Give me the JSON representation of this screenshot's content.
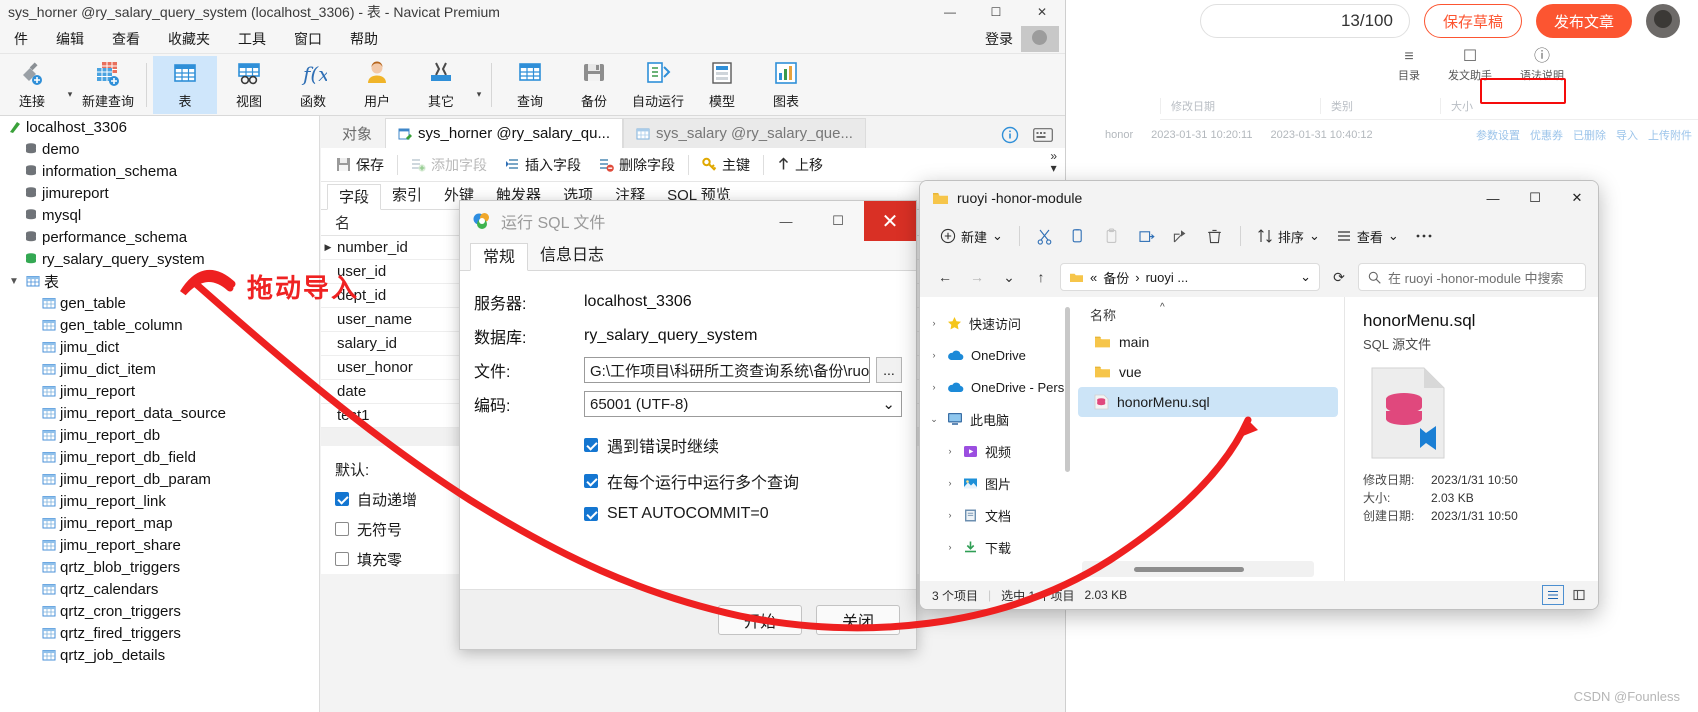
{
  "csdn": {
    "counter": "13/100",
    "save_draft": "保存草稿",
    "publish": "发布文章",
    "avatar": "user-avatar",
    "tools": [
      {
        "icon": "list-outline-icon",
        "label": "目录"
      },
      {
        "icon": "assistant-icon",
        "label": "发文助手"
      },
      {
        "icon": "help-circle-icon",
        "label": "语法说明"
      }
    ],
    "table_headers": [
      "修改日期",
      "类别",
      "大小"
    ],
    "table_row": {
      "name": "honor",
      "c1": "2023-01-31 10:20:11",
      "c2": "2023-01-31 10:40:12"
    },
    "row_links": [
      "参数设置",
      "优惠券",
      "已删除",
      "导入",
      "上传附件"
    ],
    "watermark": "CSDN @Founless"
  },
  "navicat": {
    "title": "sys_horner @ry_salary_query_system (localhost_3306) - 表 - Navicat Premium",
    "window_buttons": {
      "minimize": "—",
      "maximize": "☐",
      "close": "✕"
    },
    "menus": [
      "件",
      "编辑",
      "查看",
      "收藏夹",
      "工具",
      "窗口",
      "帮助"
    ],
    "login_label": "登录",
    "toolbar": [
      {
        "label": "连接",
        "icon": "connection-icon",
        "caret": true,
        "active": false
      },
      {
        "label": "新建查询",
        "icon": "new-query-icon",
        "caret": false,
        "active": false
      },
      {
        "label": "表",
        "icon": "table-icon",
        "caret": false,
        "active": true
      },
      {
        "label": "视图",
        "icon": "view-icon",
        "caret": false,
        "active": false
      },
      {
        "label": "函数",
        "icon": "function-icon",
        "caret": false,
        "active": false
      },
      {
        "label": "用户",
        "icon": "user-icon",
        "caret": false,
        "active": false
      },
      {
        "label": "其它",
        "icon": "other-tools-icon",
        "caret": true,
        "active": false
      },
      {
        "label": "查询",
        "icon": "query-icon",
        "caret": false,
        "active": false
      },
      {
        "label": "备份",
        "icon": "backup-icon",
        "caret": false,
        "active": false
      },
      {
        "label": "自动运行",
        "icon": "automation-icon",
        "caret": false,
        "active": false
      },
      {
        "label": "模型",
        "icon": "model-icon",
        "caret": false,
        "active": false
      },
      {
        "label": "图表",
        "icon": "chart-icon",
        "caret": false,
        "active": false
      }
    ],
    "tree": {
      "connection": {
        "label": "localhost_3306",
        "icon": "connection-node-icon"
      },
      "databases": [
        {
          "label": "demo",
          "icon": "database-icon",
          "active": false
        },
        {
          "label": "information_schema",
          "icon": "database-icon",
          "active": false
        },
        {
          "label": "jimureport",
          "icon": "database-icon",
          "active": false
        },
        {
          "label": "mysql",
          "icon": "database-icon",
          "active": false
        },
        {
          "label": "performance_schema",
          "icon": "database-icon",
          "active": false
        },
        {
          "label": "ry_salary_query_system",
          "icon": "database-icon",
          "active": true
        }
      ],
      "tables_group": {
        "label": "表",
        "icon": "tables-folder-icon",
        "expanded": true
      },
      "tables": [
        "gen_table",
        "gen_table_column",
        "jimu_dict",
        "jimu_dict_item",
        "jimu_report",
        "jimu_report_data_source",
        "jimu_report_db",
        "jimu_report_db_field",
        "jimu_report_db_param",
        "jimu_report_link",
        "jimu_report_map",
        "jimu_report_share",
        "qrtz_blob_triggers",
        "qrtz_calendars",
        "qrtz_cron_triggers",
        "qrtz_fired_triggers",
        "qrtz_job_details"
      ]
    },
    "tabs": [
      {
        "label": "对象",
        "icon": "",
        "state": "plain"
      },
      {
        "label": "sys_horner @ry_salary_qu...",
        "icon": "table-design-icon",
        "state": "active"
      },
      {
        "label": "sys_salary @ry_salary_que...",
        "icon": "table-data-icon",
        "state": "inactive"
      }
    ],
    "tab_actions": [
      {
        "icon": "info-circle-icon"
      },
      {
        "icon": "keyboard-icon"
      }
    ],
    "subtoolbar": [
      {
        "label": "保存",
        "icon": "save-icon",
        "dim": false
      },
      {
        "label": "添加字段",
        "icon": "add-field-icon",
        "dim": true
      },
      {
        "label": "插入字段",
        "icon": "insert-field-icon",
        "dim": false
      },
      {
        "label": "删除字段",
        "icon": "delete-field-icon",
        "dim": false
      },
      {
        "label": "主键",
        "icon": "primary-key-icon",
        "dim": false
      },
      {
        "label": "上移",
        "icon": "move-up-icon",
        "dim": false
      }
    ],
    "field_tabs": [
      "字段",
      "索引",
      "外键",
      "触发器",
      "选项",
      "注释",
      "SQL 预览"
    ],
    "grid_header": [
      "名"
    ],
    "grid_rows": [
      {
        "name": "number_id",
        "current": true
      },
      {
        "name": "user_id",
        "current": false
      },
      {
        "name": "dept_id",
        "current": false
      },
      {
        "name": "user_name",
        "current": false
      },
      {
        "name": "salary_id",
        "current": false
      },
      {
        "name": "user_honor",
        "current": false
      },
      {
        "name": "date",
        "current": false
      },
      {
        "name": "test1",
        "current": false
      }
    ],
    "props": {
      "default_label": "默认:",
      "auto_increment": {
        "label": "自动递增",
        "checked": true
      },
      "unsigned": {
        "label": "无符号",
        "checked": false
      },
      "zerofill": {
        "label": "填充零",
        "checked": false
      }
    }
  },
  "sqldialog": {
    "title": "运行 SQL 文件",
    "icon": "navicat-logo-icon",
    "window_buttons": {
      "minimize": "—",
      "maximize": "☐",
      "close": "✕"
    },
    "tabs": [
      {
        "label": "常规",
        "active": true
      },
      {
        "label": "信息日志",
        "active": false
      }
    ],
    "fields": [
      {
        "label": "服务器:",
        "value": "localhost_3306"
      },
      {
        "label": "数据库:",
        "value": "ry_salary_query_system"
      }
    ],
    "file": {
      "label": "文件:",
      "value": "G:\\工作项目\\科研所工资查询系统\\备份\\ruoyi",
      "browse": "..."
    },
    "encoding": {
      "label": "编码:",
      "value": "65001 (UTF-8)",
      "caret": "⌄"
    },
    "checkboxes": [
      {
        "label": "遇到错误时继续",
        "checked": true
      },
      {
        "label": "在每个运行中运行多个查询",
        "checked": true
      },
      {
        "label": "SET AUTOCOMMIT=0",
        "checked": true
      }
    ],
    "buttons": [
      {
        "label": "开始",
        "name": "start"
      },
      {
        "label": "关闭",
        "name": "close"
      }
    ]
  },
  "explorer": {
    "title": "ruoyi -honor-module",
    "folder_icon": "folder-icon",
    "window_buttons": {
      "minimize": "—",
      "maximize": "☐",
      "close": "✕"
    },
    "toolbar": [
      {
        "icon": "plus-circle-icon",
        "label": "新建",
        "caret": "⌄",
        "dim": false
      },
      {
        "icon": "cut-icon",
        "label": "",
        "caret": "",
        "dim": false
      },
      {
        "icon": "copy-icon",
        "label": "",
        "caret": "",
        "dim": false
      },
      {
        "icon": "paste-icon",
        "label": "",
        "caret": "",
        "dim": true
      },
      {
        "icon": "rename-icon",
        "label": "",
        "caret": "",
        "dim": false
      },
      {
        "icon": "share-icon",
        "label": "",
        "caret": "",
        "dim": false
      },
      {
        "icon": "delete-icon",
        "label": "",
        "caret": "",
        "dim": false
      },
      {
        "icon": "sort-icon",
        "label": "排序",
        "caret": "⌄",
        "dim": false
      },
      {
        "icon": "view-list-icon",
        "label": "查看",
        "caret": "⌄",
        "dim": false
      },
      {
        "icon": "more-icon",
        "label": "",
        "caret": "",
        "dim": false
      }
    ],
    "nav_buttons": {
      "back": "←",
      "forward": "→",
      "recent": "⌄",
      "up": "↑",
      "refresh": "⟳"
    },
    "path": {
      "prefix": "«",
      "crumbs": [
        "备份",
        "ruoyi ..."
      ],
      "caret": "⌄"
    },
    "search_placeholder": "在 ruoyi -honor-module 中搜索",
    "nav_tree": [
      {
        "label": "快速访问",
        "icon": "star-icon",
        "chev": "›",
        "indent": false
      },
      {
        "label": "OneDrive",
        "icon": "onedrive-icon",
        "chev": "›",
        "indent": false
      },
      {
        "label": "OneDrive - Pers",
        "icon": "onedrive-icon",
        "chev": "›",
        "indent": false
      },
      {
        "label": "此电脑",
        "icon": "this-pc-icon",
        "chev": "⌄",
        "indent": false
      },
      {
        "label": "视频",
        "icon": "videos-icon",
        "chev": "›",
        "indent": true
      },
      {
        "label": "图片",
        "icon": "pictures-icon",
        "chev": "›",
        "indent": true
      },
      {
        "label": "文档",
        "icon": "documents-icon",
        "chev": "›",
        "indent": true
      },
      {
        "label": "下载",
        "icon": "downloads-icon",
        "chev": "›",
        "indent": true
      }
    ],
    "list_header": "名称",
    "files": [
      {
        "name": "main",
        "icon": "folder-icon",
        "selected": false
      },
      {
        "name": "vue",
        "icon": "folder-icon",
        "selected": false
      },
      {
        "name": "honorMenu.sql",
        "icon": "sql-file-icon",
        "selected": true
      }
    ],
    "preview": {
      "name": "honorMenu.sql",
      "type": "SQL 源文件",
      "icon": "sql-file-large-icon",
      "meta": [
        {
          "key": "修改日期:",
          "value": "2023/1/31 10:50"
        },
        {
          "key": "大小:",
          "value": "2.03 KB"
        },
        {
          "key": "创建日期:",
          "value": "2023/1/31 10:50"
        }
      ]
    },
    "status": {
      "count": "3 个项目",
      "selection": "选中 1 个项目",
      "size": "2.03 KB"
    },
    "view_buttons": [
      {
        "icon": "details-view-icon",
        "active": true
      },
      {
        "icon": "tiles-view-icon",
        "active": false
      }
    ]
  },
  "annotation": {
    "text": "拖动导入",
    "color": "#ee2020"
  }
}
